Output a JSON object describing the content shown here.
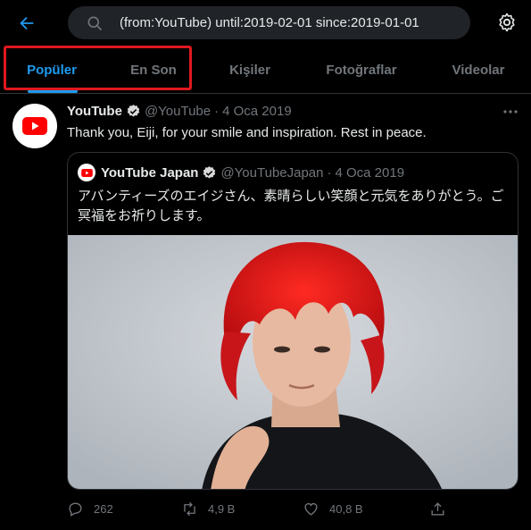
{
  "search": {
    "query": "(from:YouTube) until:2019-02-01 since:2019-01-01"
  },
  "tabs": [
    {
      "label": "Popüler",
      "active": true
    },
    {
      "label": "En Son",
      "active": false
    },
    {
      "label": "Kişiler",
      "active": false
    },
    {
      "label": "Fotoğraflar",
      "active": false
    },
    {
      "label": "Videolar",
      "active": false
    }
  ],
  "tweet": {
    "name": "YouTube",
    "handle": "@YouTube",
    "separator": "·",
    "date": "4 Oca 2019",
    "text": "Thank you, Eiji, for your smile and inspiration. Rest in peace.",
    "quote": {
      "name": "YouTube Japan",
      "handle": "@YouTubeJapan",
      "separator": "·",
      "date": "4 Oca 2019",
      "text": "アバンティーズのエイジさん、素晴らしい笑顔と元気をありがとう。ご冥福をお祈りします。"
    },
    "actions": {
      "replies": "262",
      "retweets": "4,9 B",
      "likes": "40,8 B"
    }
  },
  "colors": {
    "accent": "#1d9bf0",
    "highlight": "#e0181f",
    "youtube_red": "#ff0000"
  }
}
